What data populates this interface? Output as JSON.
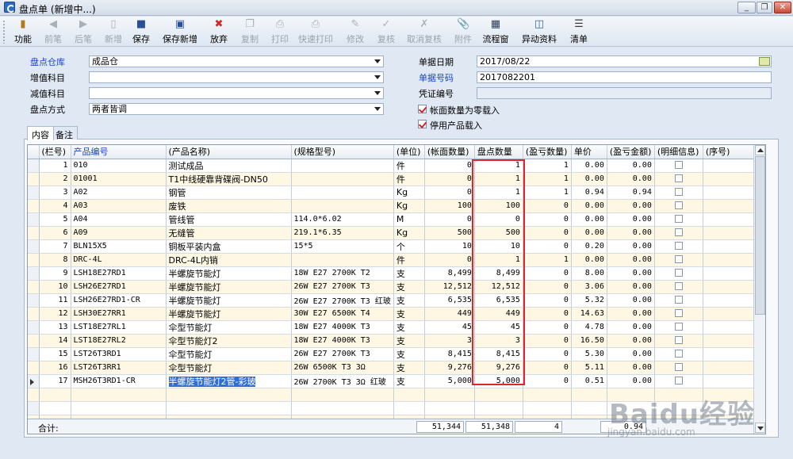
{
  "window": {
    "title": "盘点单 (新增中...)",
    "min": "_",
    "max": "□",
    "restore": "❐",
    "close": "✕"
  },
  "toolbar": [
    {
      "label": "功能",
      "icon": "function-icon",
      "enabled": true
    },
    {
      "label": "前笔",
      "icon": "arrow-left-icon",
      "enabled": false
    },
    {
      "label": "后笔",
      "icon": "arrow-right-icon",
      "enabled": false
    },
    {
      "label": "新增",
      "icon": "new-doc-icon",
      "enabled": false
    },
    {
      "label": "保存",
      "icon": "save-icon",
      "enabled": true
    },
    {
      "label": "保存新增",
      "icon": "save-new-icon",
      "enabled": true
    },
    {
      "label": "放弃",
      "icon": "cancel-icon",
      "enabled": true
    },
    {
      "label": "复制",
      "icon": "copy-icon",
      "enabled": false
    },
    {
      "label": "打印",
      "icon": "print-icon",
      "enabled": false
    },
    {
      "label": "快速打印",
      "icon": "quick-print-icon",
      "enabled": false
    },
    {
      "label": "修改",
      "icon": "edit-icon",
      "enabled": false
    },
    {
      "label": "复核",
      "icon": "review-icon",
      "enabled": false
    },
    {
      "label": "取消复核",
      "icon": "unreview-icon",
      "enabled": false
    },
    {
      "label": "附件",
      "icon": "attachment-icon",
      "enabled": false
    },
    {
      "label": "流程窗",
      "icon": "flow-window-icon",
      "enabled": true
    },
    {
      "label": "异动资料",
      "icon": "change-data-icon",
      "enabled": true
    },
    {
      "label": "清单",
      "icon": "list-icon",
      "enabled": true
    }
  ],
  "form": {
    "warehouse_label": "盘点仓库",
    "warehouse_value": "成品仓",
    "increase_label": "增值科目",
    "increase_value": "",
    "decrease_label": "减值科目",
    "decrease_value": "",
    "method_label": "盘点方式",
    "method_value": "两者皆调",
    "date_label": "单据日期",
    "date_value": "2017/08/22",
    "docno_label": "单据号码",
    "docno_value": "2017082201",
    "voucher_label": "凭证编号",
    "voucher_value": "",
    "zero_qty_label": "帐面数量为零载入",
    "disabled_product_label": "停用产品载入"
  },
  "tabs": [
    "内容",
    "备注"
  ],
  "grid": {
    "headers": [
      "(栏号)",
      "产品编号",
      "(产品名称)",
      "(规格型号)",
      "(单位)",
      "(帐面数量)",
      "盘点数量",
      "(盈亏数量)",
      "单价",
      "(盈亏金额)",
      "(明细信息)",
      "(序号)"
    ],
    "rows": [
      [
        "1",
        "010",
        "测试成品",
        "",
        "件",
        "0",
        "1",
        "1",
        "0.00",
        "0.00"
      ],
      [
        "2",
        "01001",
        "T1中线硬靠背碟阀-DN50",
        "",
        "件",
        "0",
        "1",
        "1",
        "0.00",
        "0.00"
      ],
      [
        "3",
        "A02",
        "钢管",
        "",
        "Kg",
        "0",
        "1",
        "1",
        "0.94",
        "0.94"
      ],
      [
        "4",
        "A03",
        "废铁",
        "",
        "Kg",
        "100",
        "100",
        "0",
        "0.00",
        "0.00"
      ],
      [
        "5",
        "A04",
        "管线管",
        "114.0*6.02",
        "M",
        "0",
        "0",
        "0",
        "0.00",
        "0.00"
      ],
      [
        "6",
        "A09",
        "无缝管",
        "219.1*6.35",
        "Kg",
        "500",
        "500",
        "0",
        "0.00",
        "0.00"
      ],
      [
        "7",
        "BLN15X5",
        "铜板平装内盒",
        "15*5",
        "个",
        "10",
        "10",
        "0",
        "0.20",
        "0.00"
      ],
      [
        "8",
        "DRC-4L",
        "DRC-4L内销",
        "",
        "件",
        "0",
        "1",
        "1",
        "0.00",
        "0.00"
      ],
      [
        "9",
        "LSH18E27RD1",
        "半螺旋节能灯",
        "18W E27 2700K T2",
        "支",
        "8,499",
        "8,499",
        "0",
        "8.00",
        "0.00"
      ],
      [
        "10",
        "LSH26E27RD1",
        "半螺旋节能灯",
        "26W E27 2700K T3",
        "支",
        "12,512",
        "12,512",
        "0",
        "3.06",
        "0.00"
      ],
      [
        "11",
        "LSH26E27RD1-CR",
        "半螺旋节能灯",
        "26W E27 2700K T3 红玻",
        "支",
        "6,535",
        "6,535",
        "0",
        "5.32",
        "0.00"
      ],
      [
        "12",
        "LSH30E27RR1",
        "半螺旋节能灯",
        "30W E27 6500K T4",
        "支",
        "449",
        "449",
        "0",
        "14.63",
        "0.00"
      ],
      [
        "13",
        "LST18E27RL1",
        "伞型节能灯",
        "18W E27 4000K T3",
        "支",
        "45",
        "45",
        "0",
        "4.78",
        "0.00"
      ],
      [
        "14",
        "LST18E27RL2",
        "伞型节能灯2",
        "18W E27 4000K T3",
        "支",
        "3",
        "3",
        "0",
        "16.50",
        "0.00"
      ],
      [
        "15",
        "LST26T3RD1",
        "伞型节能灯",
        "26W E27 2700K T3",
        "支",
        "8,415",
        "8,415",
        "0",
        "5.30",
        "0.00"
      ],
      [
        "16",
        "LST26T3RR1",
        "伞型节能灯",
        "26W 6500K T3 3Ω",
        "支",
        "9,276",
        "9,276",
        "0",
        "5.11",
        "0.00"
      ],
      [
        "17",
        "MSH26T3RD1-CR",
        "半螺旋节能灯2管-彩玻",
        "26W 2700K T3 3Ω 红玻",
        "支",
        "5,000",
        "5,000",
        "0",
        "0.51",
        "0.00"
      ]
    ],
    "total_label": "合计:",
    "totals": {
      "book_qty": "51,344",
      "count_qty": "51,348",
      "diff_qty": "4",
      "diff_amount": "0.94"
    }
  },
  "watermark": {
    "text": "Baidu经验",
    "sub": "jingyan.baidu.com"
  }
}
